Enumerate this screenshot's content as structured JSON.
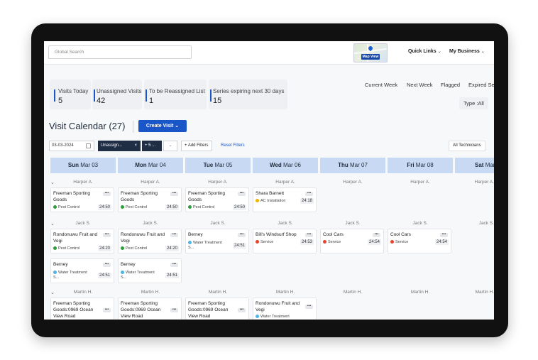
{
  "header": {
    "search_placeholder": "Global Search",
    "map_label": "Map View",
    "quick_links": "Quick Links",
    "my_business": "My Business"
  },
  "stats": [
    {
      "label": "Visits Today",
      "value": "5"
    },
    {
      "label": "Unassigned Visits",
      "value": "42"
    },
    {
      "label": "To be Reassigned List",
      "value": "1"
    },
    {
      "label": "Series expiring next 30 days",
      "value": "15"
    }
  ],
  "quick_filters": [
    "Current Week",
    "Next Week",
    "Flagged",
    "Expired Se"
  ],
  "type_filter": "Type :All",
  "title": "Visit Calendar",
  "count": "(27)",
  "create_button": "Create Visit",
  "filters": {
    "date": "03-03-2024",
    "chip1": "Unassign...",
    "chip1_close": "×",
    "chip2": "+ 5 ...",
    "add_filters": "+ Add Filters",
    "reset_filters": "Reset Filters",
    "all_technicians": "All Technicians"
  },
  "days": [
    {
      "dow": "Sun",
      "date": "Mar 03"
    },
    {
      "dow": "Mon",
      "date": "Mar 04"
    },
    {
      "dow": "Tue",
      "date": "Mar 05"
    },
    {
      "dow": "Wed",
      "date": "Mar 06"
    },
    {
      "dow": "Thu",
      "date": "Mar 07"
    },
    {
      "dow": "Fri",
      "date": "Mar 08"
    },
    {
      "dow": "Sat",
      "date": "Mar"
    }
  ],
  "technicians": [
    "Harper A.",
    "Jack S.",
    "Martin H."
  ],
  "more_glyph": "•••",
  "colors": {
    "pest_control": "#2e9e3c",
    "ac_installation": "#f2b400",
    "service": "#e8432e",
    "water_treatment": "#4fb3e8",
    "accent": "#1b56c8"
  },
  "cards": {
    "harper": [
      {
        "name": "Freeman Sporting Goods",
        "service": "Pest Control",
        "time": "24:50",
        "color": "#2e9e3c"
      },
      {
        "name": "Freeman Sporting Goods",
        "service": "Pest Control",
        "time": "24:50",
        "color": "#2e9e3c"
      },
      {
        "name": "Freeman Sporting Goods",
        "service": "Pest Control",
        "time": "24:50",
        "color": "#2e9e3c"
      },
      {
        "name": "Shara Barnett",
        "service": "AC Installation",
        "time": "24:18",
        "color": "#f2b400"
      }
    ],
    "jack1": [
      {
        "name": "Rondonuwu Fruit and Vegi",
        "service": "Pest Control",
        "time": "24:20",
        "color": "#2e9e3c"
      },
      {
        "name": "Rondonuwu Fruit and Vegi",
        "service": "Pest Control",
        "time": "24:20",
        "color": "#2e9e3c"
      },
      {
        "name": "Berney",
        "service": "Water Treatment S...",
        "time": "24:51",
        "color": "#4fb3e8"
      },
      {
        "name": "Bill's Windsurf Shop",
        "service": "Service",
        "time": "24:53",
        "color": "#e8432e"
      },
      {
        "name": "Cool Cars",
        "service": "Service",
        "time": "24:54",
        "color": "#e8432e"
      },
      {
        "name": "Cool Cars",
        "service": "Service",
        "time": "24:54",
        "color": "#e8432e"
      }
    ],
    "jack2": [
      {
        "name": "Berney",
        "service": "Water Treatment S...",
        "time": "24:51",
        "color": "#4fb3e8"
      },
      {
        "name": "Berney",
        "service": "Water Treatment S...",
        "time": "24:51",
        "color": "#4fb3e8"
      }
    ],
    "martin": [
      {
        "name": "Freeman Sporting Goods:0969 Ocean View Road",
        "service": "",
        "time": "",
        "color": "#2e9e3c"
      },
      {
        "name": "Freeman Sporting Goods:0969 Ocean View Road",
        "service": "",
        "time": "",
        "color": "#2e9e3c"
      },
      {
        "name": "Freeman Sporting Goods:0969 Ocean View Road",
        "service": "",
        "time": "",
        "color": "#2e9e3c"
      },
      {
        "name": "Rondonuwu Fruit and Vegi",
        "service": "Water Treatment",
        "time": "",
        "color": "#4fb3e8"
      }
    ]
  }
}
